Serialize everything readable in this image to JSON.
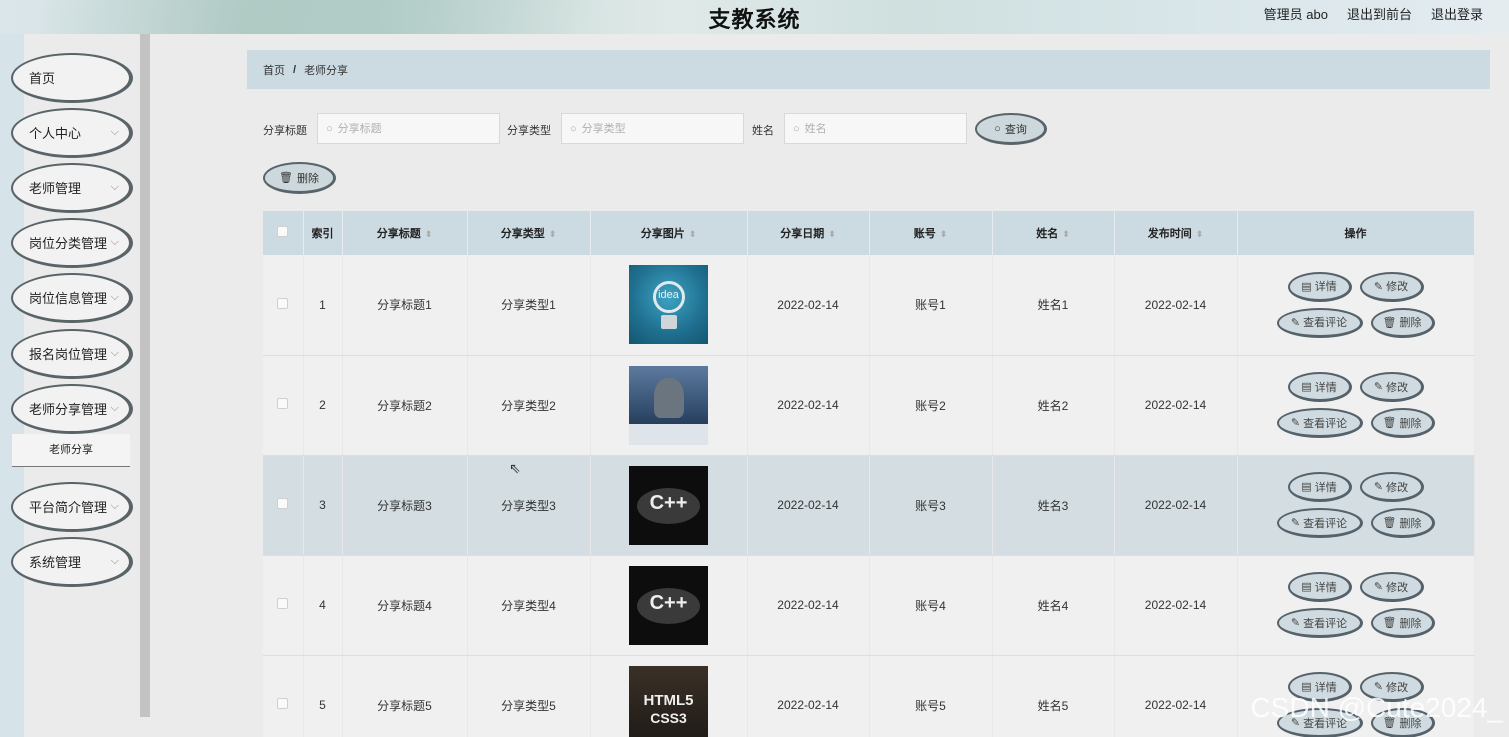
{
  "header": {
    "title": "支教系统",
    "user_label": "管理员 abo",
    "to_front_label": "退出到前台",
    "logout_label": "退出登录"
  },
  "sidebar": {
    "items": [
      {
        "label": "首页",
        "has_children": false
      },
      {
        "label": "个人中心",
        "has_children": true
      },
      {
        "label": "老师管理",
        "has_children": true
      },
      {
        "label": "岗位分类管理",
        "has_children": true
      },
      {
        "label": "岗位信息管理",
        "has_children": true
      },
      {
        "label": "报名岗位管理",
        "has_children": true
      },
      {
        "label": "老师分享管理",
        "has_children": true
      },
      {
        "label": "平台简介管理",
        "has_children": true
      },
      {
        "label": "系统管理",
        "has_children": true
      }
    ],
    "active_subitem": "老师分享"
  },
  "breadcrumb": {
    "home": "首页",
    "separator": "/",
    "current": "老师分享"
  },
  "search": {
    "title_label": "分享标题",
    "title_placeholder": "分享标题",
    "type_label": "分享类型",
    "type_placeholder": "分享类型",
    "name_label": "姓名",
    "name_placeholder": "姓名",
    "query_button": "查询",
    "delete_button": "删除"
  },
  "table": {
    "columns": [
      "索引",
      "分享标题",
      "分享类型",
      "分享图片",
      "分享日期",
      "账号",
      "姓名",
      "发布时间",
      "操作"
    ],
    "rows": [
      {
        "index": "1",
        "title": "分享标题1",
        "type": "分享类型1",
        "image": "idea-lightbulb",
        "date": "2022-02-14",
        "account": "账号1",
        "name": "姓名1",
        "publish_time": "2022-02-14"
      },
      {
        "index": "2",
        "title": "分享标题2",
        "type": "分享类型2",
        "image": "hacker",
        "date": "2022-02-14",
        "account": "账号2",
        "name": "姓名2",
        "publish_time": "2022-02-14"
      },
      {
        "index": "3",
        "title": "分享标题3",
        "type": "分享类型3",
        "image": "cpp-word-cloud",
        "date": "2022-02-14",
        "account": "账号3",
        "name": "姓名3",
        "publish_time": "2022-02-14"
      },
      {
        "index": "4",
        "title": "分享标题4",
        "type": "分享类型4",
        "image": "cpp-word-cloud",
        "date": "2022-02-14",
        "account": "账号4",
        "name": "姓名4",
        "publish_time": "2022-02-14"
      },
      {
        "index": "5",
        "title": "分享标题5",
        "type": "分享类型5",
        "image": "html5-css3",
        "date": "2022-02-14",
        "account": "账号5",
        "name": "姓名5",
        "publish_time": "2022-02-14"
      }
    ],
    "actions": {
      "detail": "详情",
      "edit": "修改",
      "comments": "查看评论",
      "delete": "删除"
    },
    "thumb_text": {
      "idea": "idea",
      "cpp": "C++",
      "html5": "HTML5",
      "css3": "CSS3"
    }
  },
  "watermark": "CSDN @Cute2024_",
  "colors": {
    "accent": "#ccdbe1",
    "highlight_row": "#d3dde2",
    "button_border": "#59646a"
  }
}
